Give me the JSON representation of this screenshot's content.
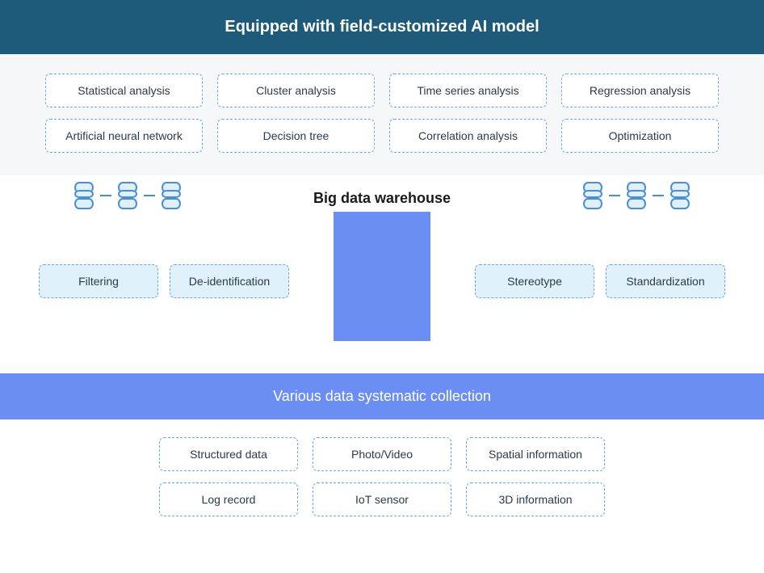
{
  "headerTop": "Equipped with field-customized AI model",
  "aiModels": {
    "row1": [
      "Statistical analysis",
      "Cluster analysis",
      "Time series analysis",
      "Regression analysis"
    ],
    "row2": [
      "Artificial neural network",
      "Decision tree",
      "Correlation analysis",
      "Optimization"
    ]
  },
  "warehouse": {
    "title": "Big data warehouse"
  },
  "processLeft": [
    "Filtering",
    "De-identification"
  ],
  "processRight": [
    "Stereotype",
    "Standardization"
  ],
  "headerBottom": "Various data systematic collection",
  "dataTypes": {
    "row1": [
      "Structured data",
      "Photo/Video",
      "Spatial information"
    ],
    "row2": [
      "Log record",
      "IoT sensor",
      "3D information"
    ]
  }
}
